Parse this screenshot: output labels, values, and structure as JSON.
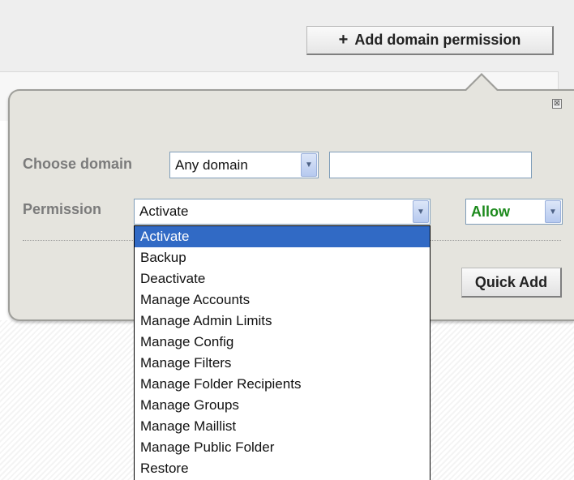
{
  "toolbar": {
    "add_domain_permission_label": "Add domain permission",
    "plus_glyph": "+"
  },
  "popup": {
    "close_glyph": "⊠",
    "choose_domain_label": "Choose domain",
    "domain_select_value": "Any domain",
    "permission_label": "Permission",
    "permission_select_value": "Activate",
    "access_select_value": "Allow",
    "quick_add_label": "Quick Add"
  },
  "permission_options": [
    "Activate",
    "Backup",
    "Deactivate",
    "Manage Accounts",
    "Manage Admin Limits",
    "Manage Config",
    "Manage Filters",
    "Manage Folder Recipients",
    "Manage Groups",
    "Manage Maillist",
    "Manage Public Folder",
    "Restore"
  ],
  "selected_option": "Activate",
  "colors": {
    "selected_highlight": "#316ac5",
    "allow_text": "#1c8a1c",
    "popup_background": "#e5e4de"
  },
  "icons": {
    "close": "close-icon",
    "dropdown": "chevron-down-icon",
    "add": "plus-icon"
  }
}
